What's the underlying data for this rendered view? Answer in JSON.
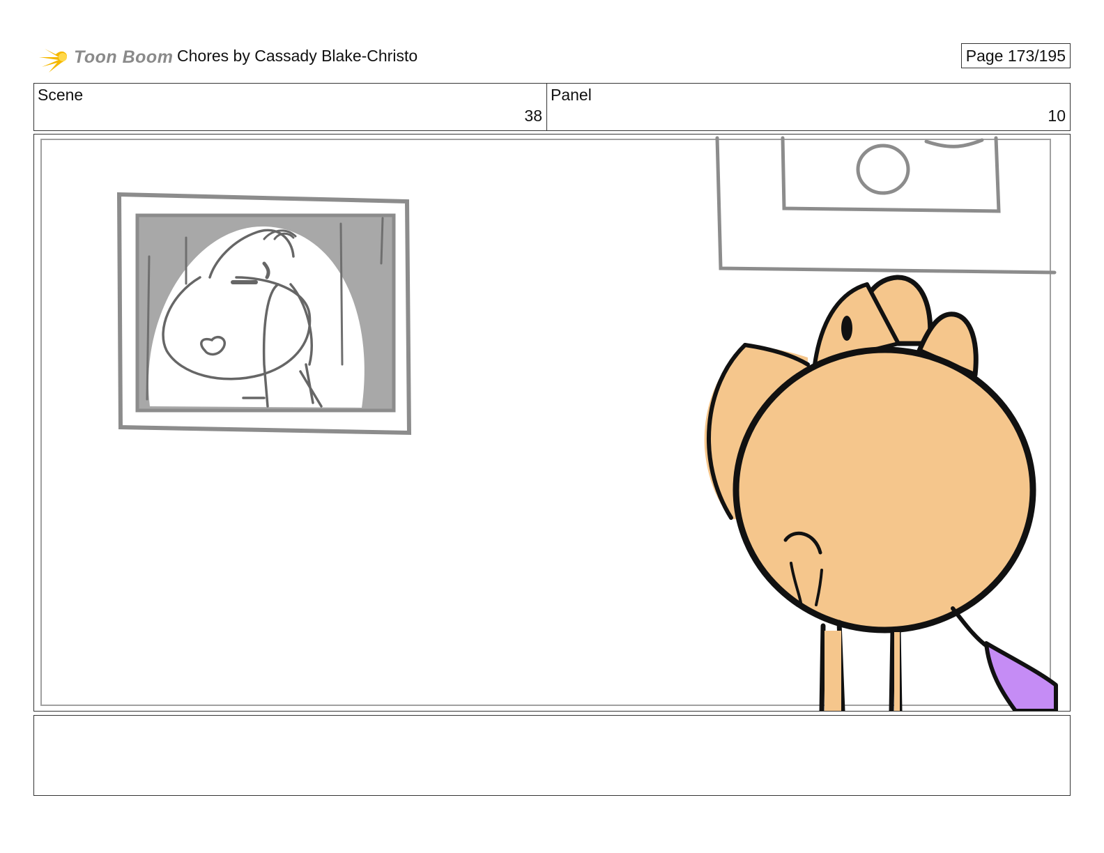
{
  "header": {
    "logo_text": "Toon Boom",
    "title": "Chores  by Cassady Blake-Christo",
    "page": "Page 173/195"
  },
  "scene": {
    "label": "Scene",
    "value": "38"
  },
  "panel": {
    "label": "Panel",
    "value": "10"
  },
  "colors": {
    "logo_flame": "#f5b800",
    "character_skin": "#f5c68c",
    "purple_object": "#c58cf5",
    "sketch_gray": "#8c8c8c"
  },
  "notes": {
    "text": ""
  }
}
